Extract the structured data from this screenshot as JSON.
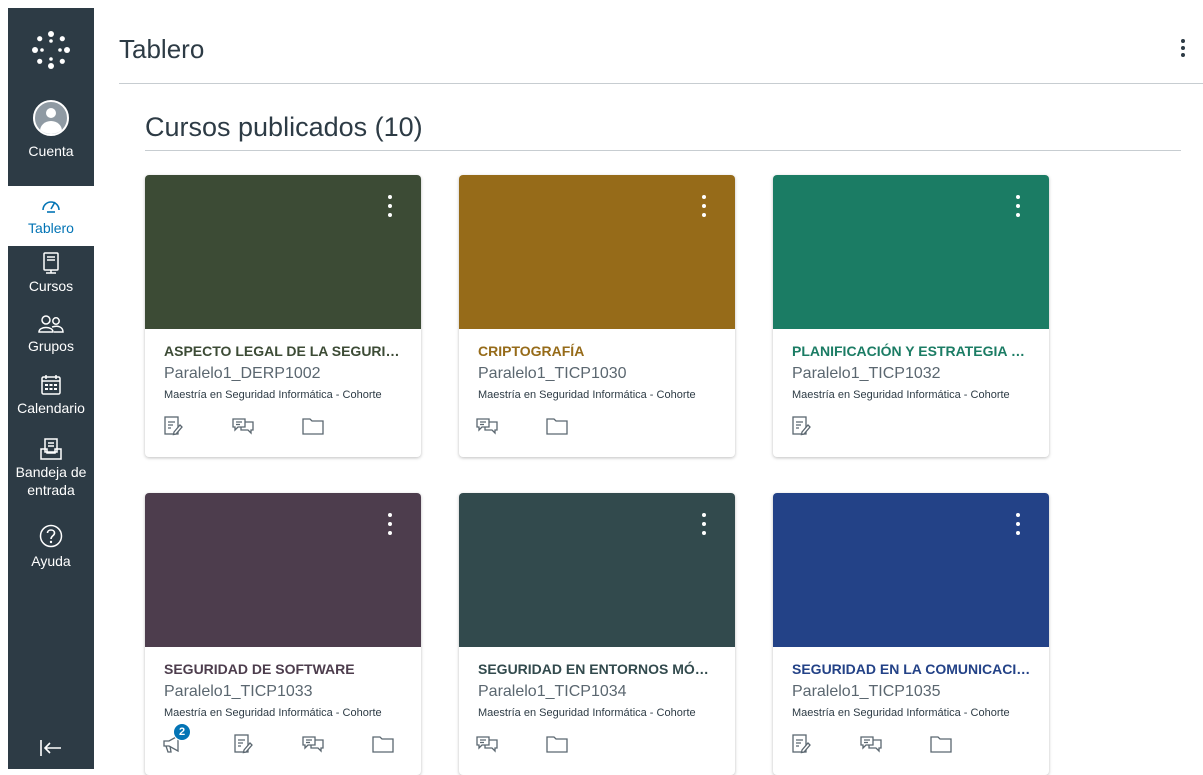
{
  "global_nav": {
    "items": [
      {
        "label": "Cuenta",
        "icon": "user-icon"
      },
      {
        "label": "Tablero",
        "icon": "dashboard-icon"
      },
      {
        "label": "Cursos",
        "icon": "courses-icon"
      },
      {
        "label": "Grupos",
        "icon": "groups-icon"
      },
      {
        "label": "Calendario",
        "icon": "calendar-icon"
      },
      {
        "label": "Bandeja de entrada",
        "icon": "inbox-icon"
      },
      {
        "label": "Ayuda",
        "icon": "help-icon"
      }
    ],
    "active_item": "Tablero",
    "background_color": "#2d3b45",
    "active_color": "#0374b5"
  },
  "header": {
    "title": "Tablero"
  },
  "section": {
    "title": "Cursos publicados (10)"
  },
  "courses": [
    {
      "title": "ASPECTO LEGAL DE LA SEGURIDAD INFORMÁTICA",
      "code": "Paralelo1_DERP1002",
      "term": "Maestría en Seguridad Informática - Cohorte",
      "color": "#3c4b35",
      "actions": [
        "assignments-icon",
        "discussions-icon",
        "files-icon"
      ],
      "badge": ""
    },
    {
      "title": "CRIPTOGRAFÍA",
      "code": "Paralelo1_TICP1030",
      "term": "Maestría en Seguridad Informática - Cohorte",
      "color": "#966b19",
      "actions": [
        "discussions-icon",
        "files-icon"
      ],
      "badge": ""
    },
    {
      "title": "PLANIFICACIÓN Y ESTRATEGIA DE SEGURIDAD",
      "code": "Paralelo1_TICP1032",
      "term": "Maestría en Seguridad Informática - Cohorte",
      "color": "#1b7c64",
      "actions": [
        "assignments-icon"
      ],
      "badge": ""
    },
    {
      "title": "SEGURIDAD DE SOFTWARE",
      "code": "Paralelo1_TICP1033",
      "term": "Maestría en Seguridad Informática - Cohorte",
      "color": "#4d3d4d",
      "actions": [
        "announcements-icon",
        "assignments-icon",
        "discussions-icon",
        "files-icon"
      ],
      "badge": "2"
    },
    {
      "title": "SEGURIDAD EN ENTORNOS MÓVILES",
      "code": "Paralelo1_TICP1034",
      "term": "Maestría en Seguridad Informática - Cohorte",
      "color": "#324a4d",
      "actions": [
        "discussions-icon",
        "files-icon"
      ],
      "badge": ""
    },
    {
      "title": "SEGURIDAD EN LA COMUNICACIÓN",
      "code": "Paralelo1_TICP1035",
      "term": "Maestría en Seguridad Informática - Cohorte",
      "color": "#234287",
      "actions": [
        "assignments-icon",
        "discussions-icon",
        "files-icon"
      ],
      "badge": ""
    }
  ]
}
